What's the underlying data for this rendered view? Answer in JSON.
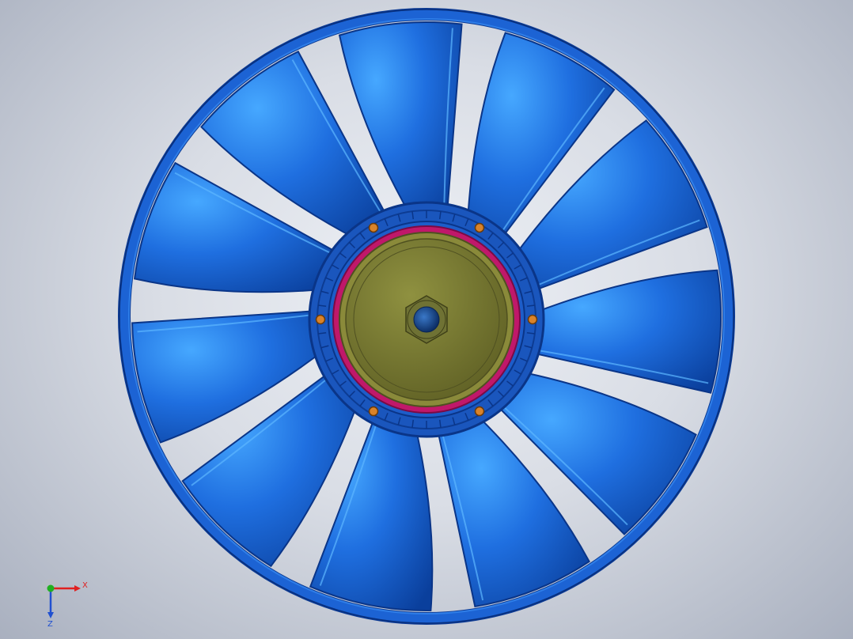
{
  "viewport": {
    "model": {
      "blade_count": 11,
      "colors": {
        "blade": "#1f6fe0",
        "blade_dark": "#0a3f9c",
        "blade_highlight": "#46a8ff",
        "shroud": "#1c63d4",
        "shroud_dark": "#0b3a94",
        "hub_ring": "#1d5dc9",
        "clutch_ring": "#c0186a",
        "clutch_body": "#8a8a3a",
        "clutch_face": "#76772f",
        "nut": "#6f7234",
        "shaft": "#1b4f9a",
        "bolt": "#d9832a"
      }
    },
    "triad": {
      "x_label": "X",
      "z_label": "Z",
      "colors": {
        "x_axis": "#e02020",
        "y_axis": "#20b020",
        "z_axis": "#2050d0"
      }
    }
  }
}
